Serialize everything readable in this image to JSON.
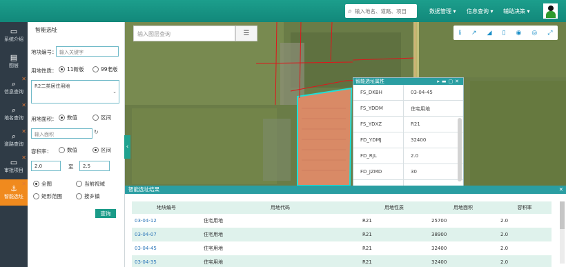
{
  "header": {
    "search_placeholder": "输入地名、道路、项目",
    "menus": [
      "数据管理 ▾",
      "信息查询 ▾",
      "辅助决策 ▾"
    ]
  },
  "leftnav": [
    {
      "label": "系统介绍",
      "icon": "monitor-icon"
    },
    {
      "label": "图层",
      "icon": "layers-icon"
    },
    {
      "label": "信息查询",
      "icon": "search-icon"
    },
    {
      "label": "地名查询",
      "icon": "search-icon"
    },
    {
      "label": "道路查询",
      "icon": "search-icon"
    },
    {
      "label": "审批项目",
      "icon": "list-icon"
    },
    {
      "label": "智能选址",
      "icon": "anchor-icon"
    }
  ],
  "panel": {
    "title": "智能选址",
    "parcel_label": "地块编号：",
    "parcel_placeholder": "输入关键字",
    "landuse_label": "用地性质：",
    "landuse_options": [
      "11新版",
      "99老版"
    ],
    "landuse_value": "R2二类居住用地",
    "area_label": "用地面积：",
    "area_options": [
      "数值",
      "区间"
    ],
    "area_placeholder": "输入面积",
    "far_label": "容积率：",
    "far_options": [
      "数值",
      "区间"
    ],
    "far_min": "2.0",
    "far_to": "至",
    "far_max": "2.5",
    "scope_options": [
      "全图",
      "当前视域",
      "矩形范围",
      "按乡镇"
    ],
    "query_button": "查询"
  },
  "map": {
    "layer_search_placeholder": "输入图层查询",
    "tool_icons": [
      "info-icon",
      "line-chart-icon",
      "area-chart-icon",
      "trash-icon",
      "globe-icon",
      "eye-icon",
      "fullscreen-icon"
    ]
  },
  "attr_window": {
    "title": "智能选址属性",
    "rows": [
      {
        "key": "FS_DKBH",
        "value": "03-04-45"
      },
      {
        "key": "FS_YDDM",
        "value": "住宅用地"
      },
      {
        "key": "FS_YDXZ",
        "value": "R21"
      },
      {
        "key": "FD_YDMJ",
        "value": "32400"
      },
      {
        "key": "FD_RJL",
        "value": "2.0"
      },
      {
        "key": "FD_JZMD",
        "value": "30"
      },
      {
        "key": "FD_LDL",
        "value": "35"
      }
    ]
  },
  "results": {
    "title": "智能选址结果",
    "columns": [
      "地块编号",
      "用地代码",
      "用地性质",
      "用地面积",
      "容积率"
    ],
    "rows": [
      [
        "03-04-12",
        "住宅用地",
        "R21",
        "25700",
        "2.0"
      ],
      [
        "03-04-07",
        "住宅用地",
        "R21",
        "38900",
        "2.0"
      ],
      [
        "03-04-45",
        "住宅用地",
        "R21",
        "32400",
        "2.0"
      ],
      [
        "03-04-35",
        "住宅用地",
        "R21",
        "32400",
        "2.0"
      ]
    ]
  }
}
